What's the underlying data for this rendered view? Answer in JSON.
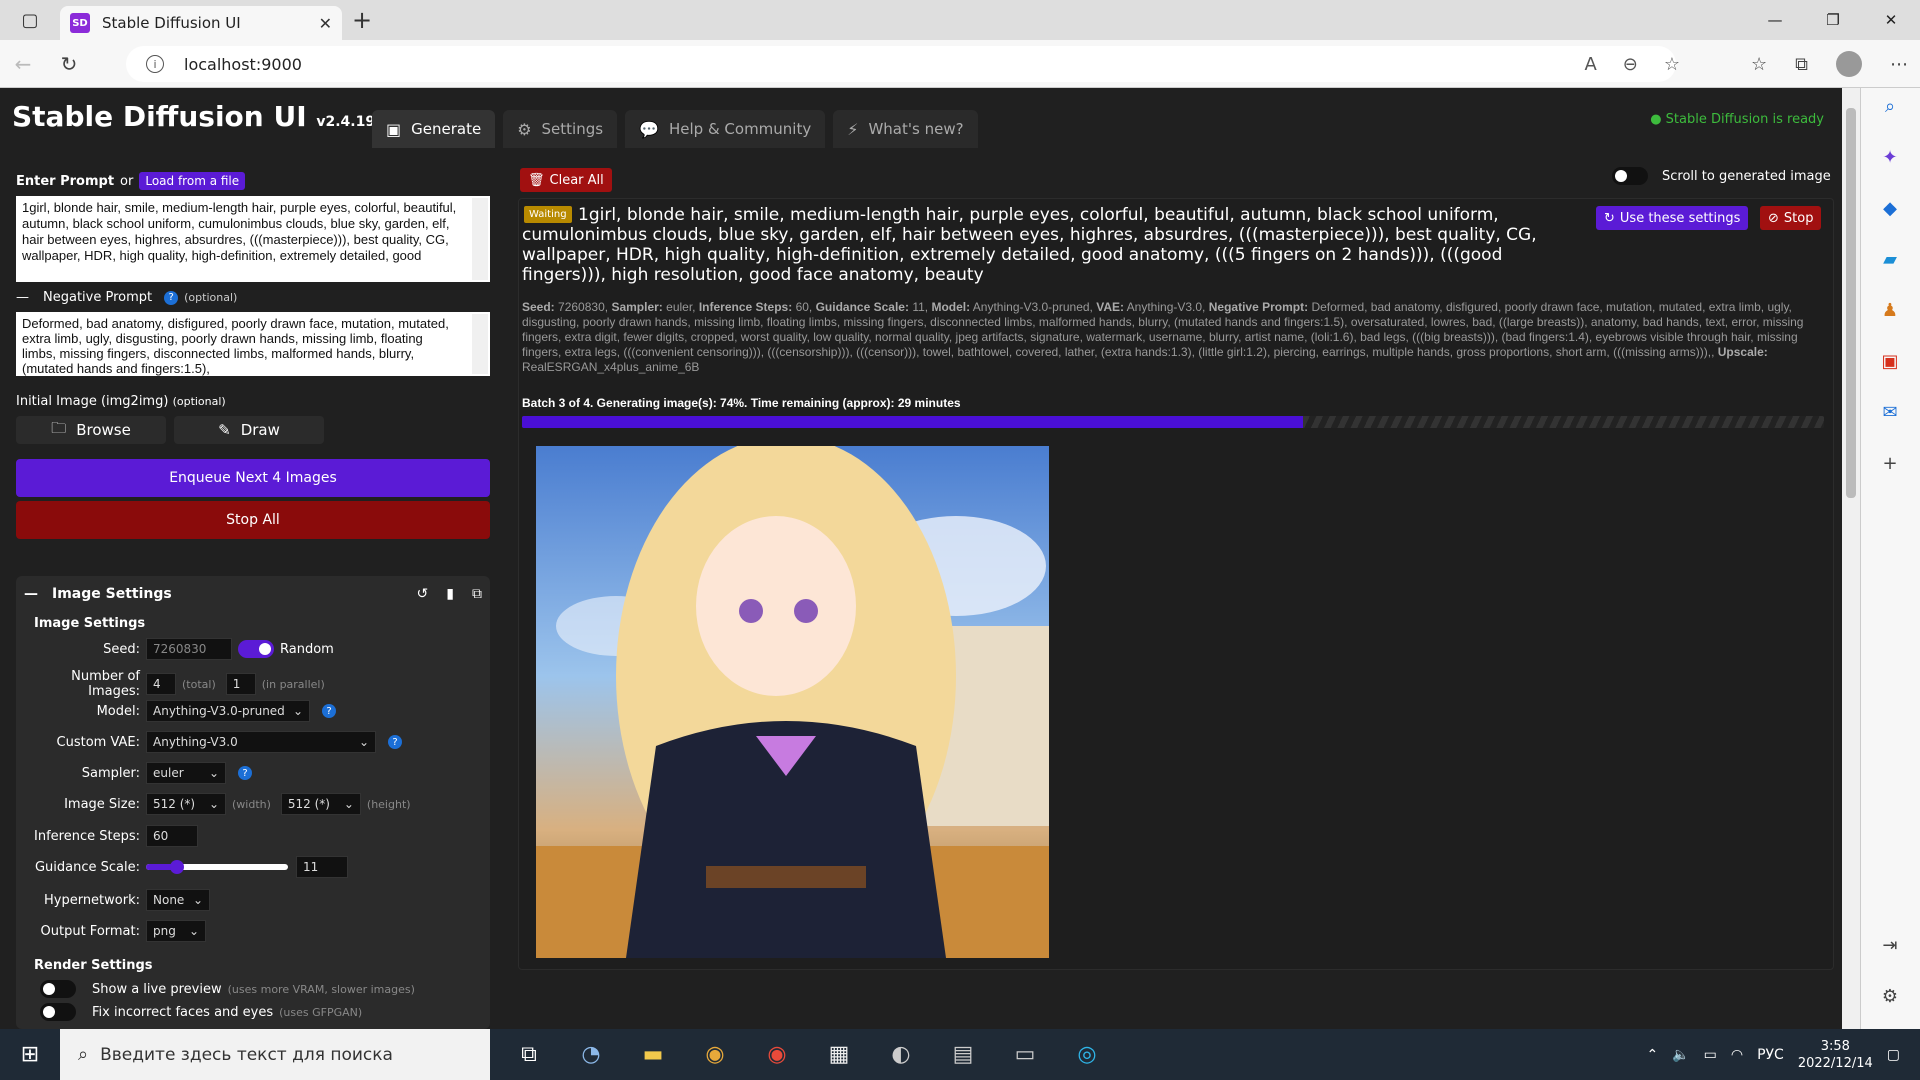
{
  "browser": {
    "tab_title": "Stable Diffusion UI",
    "favicon_text": "SD",
    "url": "localhost:9000"
  },
  "header": {
    "app_title": "Stable Diffusion UI",
    "version": "v2.4.19",
    "tabs": [
      {
        "label": "Generate",
        "icon": "image-icon"
      },
      {
        "label": "Settings",
        "icon": "gear-icon"
      },
      {
        "label": "Help & Community",
        "icon": "chat-icon"
      },
      {
        "label": "What's new?",
        "icon": "bolt-icon"
      }
    ],
    "status": "Stable Diffusion is ready"
  },
  "left": {
    "enter_prompt_label": "Enter Prompt",
    "or_label": "or",
    "load_file_label": "Load from a file",
    "prompt_value": "1girl, blonde hair, smile, medium-length hair, purple eyes, colorful, beautiful, autumn, black school uniform, cumulonimbus clouds, blue sky, garden, elf, hair between eyes, highres, absurdres, (((masterpiece))), best quality, CG, wallpaper, HDR, high quality, high-definition, extremely detailed, good",
    "negative_label": "Negative Prompt",
    "optional_label": "(optional)",
    "negative_value": "Deformed, bad anatomy, disfigured, poorly drawn face, mutation, mutated, extra limb, ugly, disgusting, poorly drawn hands, missing limb, floating limbs, missing fingers, disconnected limbs, malformed hands, blurry, (mutated hands and fingers:1.5),",
    "initial_image_label": "Initial Image (img2img)",
    "browse_label": "Browse",
    "draw_label": "Draw",
    "enqueue_label": "Enqueue Next 4 Images",
    "stop_all_label": "Stop All"
  },
  "image_settings": {
    "panel_title": "Image Settings",
    "section_title": "Image Settings",
    "seed_label": "Seed:",
    "seed_value": "7260830",
    "random_label": "Random",
    "num_images_label": "Number of Images:",
    "num_images_value": "4",
    "total_label": "(total)",
    "parallel_value": "1",
    "parallel_label": "(in parallel)",
    "model_label": "Model:",
    "model_value": "Anything-V3.0-pruned",
    "vae_label": "Custom VAE:",
    "vae_value": "Anything-V3.0",
    "sampler_label": "Sampler:",
    "sampler_value": "euler",
    "size_label": "Image Size:",
    "width_value": "512 (*)",
    "width_label": "(width)",
    "height_value": "512 (*)",
    "height_label": "(height)",
    "steps_label": "Inference Steps:",
    "steps_value": "60",
    "guidance_label": "Guidance Scale:",
    "guidance_value": "11",
    "guidance_fraction": 0.22,
    "hyper_label": "Hypernetwork:",
    "hyper_value": "None",
    "format_label": "Output Format:",
    "format_value": "png",
    "render_title": "Render Settings",
    "live_preview_label": "Show a live preview",
    "live_preview_hint": "(uses more VRAM, slower images)",
    "fix_faces_label": "Fix incorrect faces and eyes",
    "fix_faces_hint": "(uses GFPGAN)"
  },
  "main": {
    "clear_all_label": "Clear All",
    "scroll_label": "Scroll to generated image",
    "waiting_badge": "Waiting",
    "task_prompt": "1girl, blonde hair, smile, medium-length hair, purple eyes, colorful, beautiful, autumn, black school uniform, cumulonimbus clouds, blue sky, garden, elf, hair between eyes, highres, absurdres, (((masterpiece))), best quality, CG, wallpaper, HDR, high quality, high-definition, extremely detailed, good anatomy, (((5 fingers on 2 hands))), (((good fingers))), high resolution, good face anatomy, beauty",
    "use_settings_label": "Use these settings",
    "stop_label": "Stop",
    "meta": {
      "seed_k": "Seed:",
      "seed_v": "7260830,",
      "sampler_k": "Sampler:",
      "sampler_v": "euler,",
      "steps_k": "Inference Steps:",
      "steps_v": "60,",
      "guidance_k": "Guidance Scale:",
      "guidance_v": "11,",
      "model_k": "Model:",
      "model_v": "Anything-V3.0-pruned,",
      "vae_k": "VAE:",
      "vae_v": "Anything-V3.0,",
      "neg_k": "Negative Prompt:",
      "neg_v": "Deformed, bad anatomy, disfigured, poorly drawn face, mutation, mutated, extra limb, ugly, disgusting, poorly drawn hands, missing limb, floating limbs, missing fingers, disconnected limbs, malformed hands, blurry, (mutated hands and fingers:1.5), oversaturated, lowres, bad, ((large breasts)), anatomy, bad hands, text, error, missing fingers, extra digit, fewer digits, cropped, worst quality, low quality, normal quality, jpeg artifacts, signature, watermark, username, blurry, artist name, (loli:1.6), bad legs, (((big breasts))), (bad fingers:1.4), eyebrows visible through hair, missing fingers, extra legs, (((convenient censoring))), (((censorship))), (((censor))), towel, bathtowel, covered, lather, (extra hands:1.3), (little girl:1.2), piercing, earrings, multiple hands, gross proportions, short arm, (((missing arms))),,",
      "upscale_k": "Upscale:",
      "upscale_v": "RealESRGAN_x4plus_anime_6B"
    },
    "progress_text": "Batch 3 of 4. Generating image(s): 74%. Time remaining (approx): 29 minutes",
    "progress_fraction": 0.6
  },
  "taskbar": {
    "search_placeholder": "Введите здесь текст для поиска",
    "lang": "РУС",
    "time": "3:58",
    "date": "2022/12/14"
  }
}
